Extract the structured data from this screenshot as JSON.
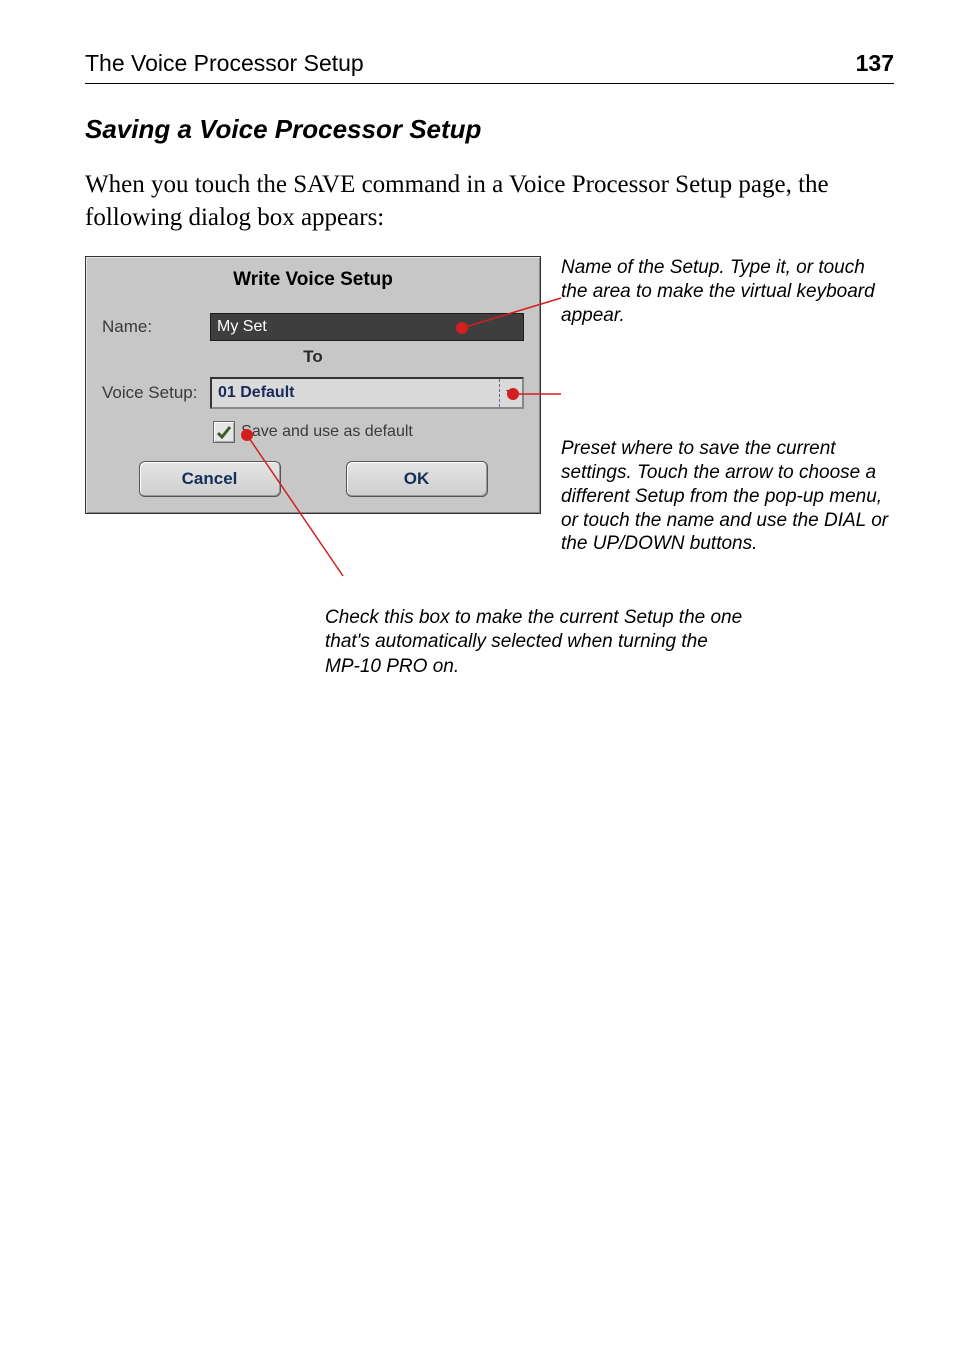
{
  "header": {
    "left": "The Voice Processor Setup",
    "right": "137"
  },
  "section_title": "Saving a Voice Processor Setup",
  "body_text": "When you touch the SAVE command in a Voice Processor Setup page, the following dialog box appears:",
  "dialog": {
    "title": "Write Voice Setup",
    "name_label": "Name:",
    "name_value": "My Set",
    "to_label": "To",
    "voice_setup_label": "Voice Setup:",
    "voice_setup_value": "01 Default",
    "checkbox_label": "Save and use as default",
    "checkbox_checked": true,
    "cancel_label": "Cancel",
    "ok_label": "OK"
  },
  "annotations": {
    "name": "Name of the Setup. Type it, or touch the area to make the virtual keyboard appear.",
    "preset": "Preset where to save the current settings. Touch the arrow to choose a different Setup from the pop-up menu, or touch the name and use the DIAL or the UP/DOWN buttons.",
    "checkbox": "Check this box to make the current Setup the one that's automatically selected when turning the MP-10 PRO on."
  },
  "callout_color": "#d31f1f"
}
